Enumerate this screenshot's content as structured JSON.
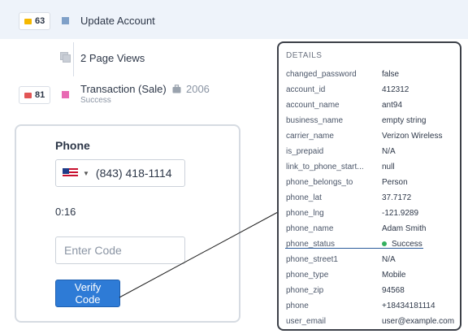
{
  "events": {
    "update_account": {
      "badge_count": "63",
      "title": "Update Account"
    },
    "page_views": {
      "title": "2 Page Views"
    },
    "transaction": {
      "badge_count": "81",
      "title": "Transaction (Sale)",
      "code": "2006",
      "status": "Success"
    }
  },
  "phone_form": {
    "label": "Phone",
    "phone_number": "(843) 418-1114",
    "timer": "0:16",
    "code_placeholder": "Enter Code",
    "verify_label": "Verify Code"
  },
  "details": {
    "title": "DETAILS",
    "rows": [
      {
        "key": "changed_password",
        "value": "false"
      },
      {
        "key": "account_id",
        "value": "412312"
      },
      {
        "key": "account_name",
        "value": "ant94"
      },
      {
        "key": "business_name",
        "value": "empty string"
      },
      {
        "key": "carrier_name",
        "value": "Verizon Wireless"
      },
      {
        "key": "is_prepaid",
        "value": "N/A"
      },
      {
        "key": "link_to_phone_start...",
        "value": "null"
      },
      {
        "key": "phone_belongs_to",
        "value": "Person"
      },
      {
        "key": "phone_lat",
        "value": "37.7172"
      },
      {
        "key": "phone_lng",
        "value": "-121.9289"
      },
      {
        "key": "phone_name",
        "value": "Adam Smith"
      },
      {
        "key": "phone_status",
        "value": "Success"
      },
      {
        "key": "phone_street1",
        "value": "N/A"
      },
      {
        "key": "phone_type",
        "value": "Mobile"
      },
      {
        "key": "phone_zip",
        "value": "94568"
      },
      {
        "key": "phone",
        "value": "+18434181114"
      },
      {
        "key": "user_email",
        "value": "user@example.com"
      }
    ]
  },
  "colors": {
    "update_account_square": "#7fa0c8",
    "transaction_square": "#e86ab3",
    "badge_yellow": "#f5b800",
    "badge_red": "#e25555",
    "success": "#34b05f",
    "accent": "#2e7bd6"
  },
  "icons": {
    "badge_icon": "card-icon",
    "page_views_icon": "pages-icon",
    "transaction_icon": "briefcase-icon",
    "flag_icon": "us-flag-icon"
  }
}
